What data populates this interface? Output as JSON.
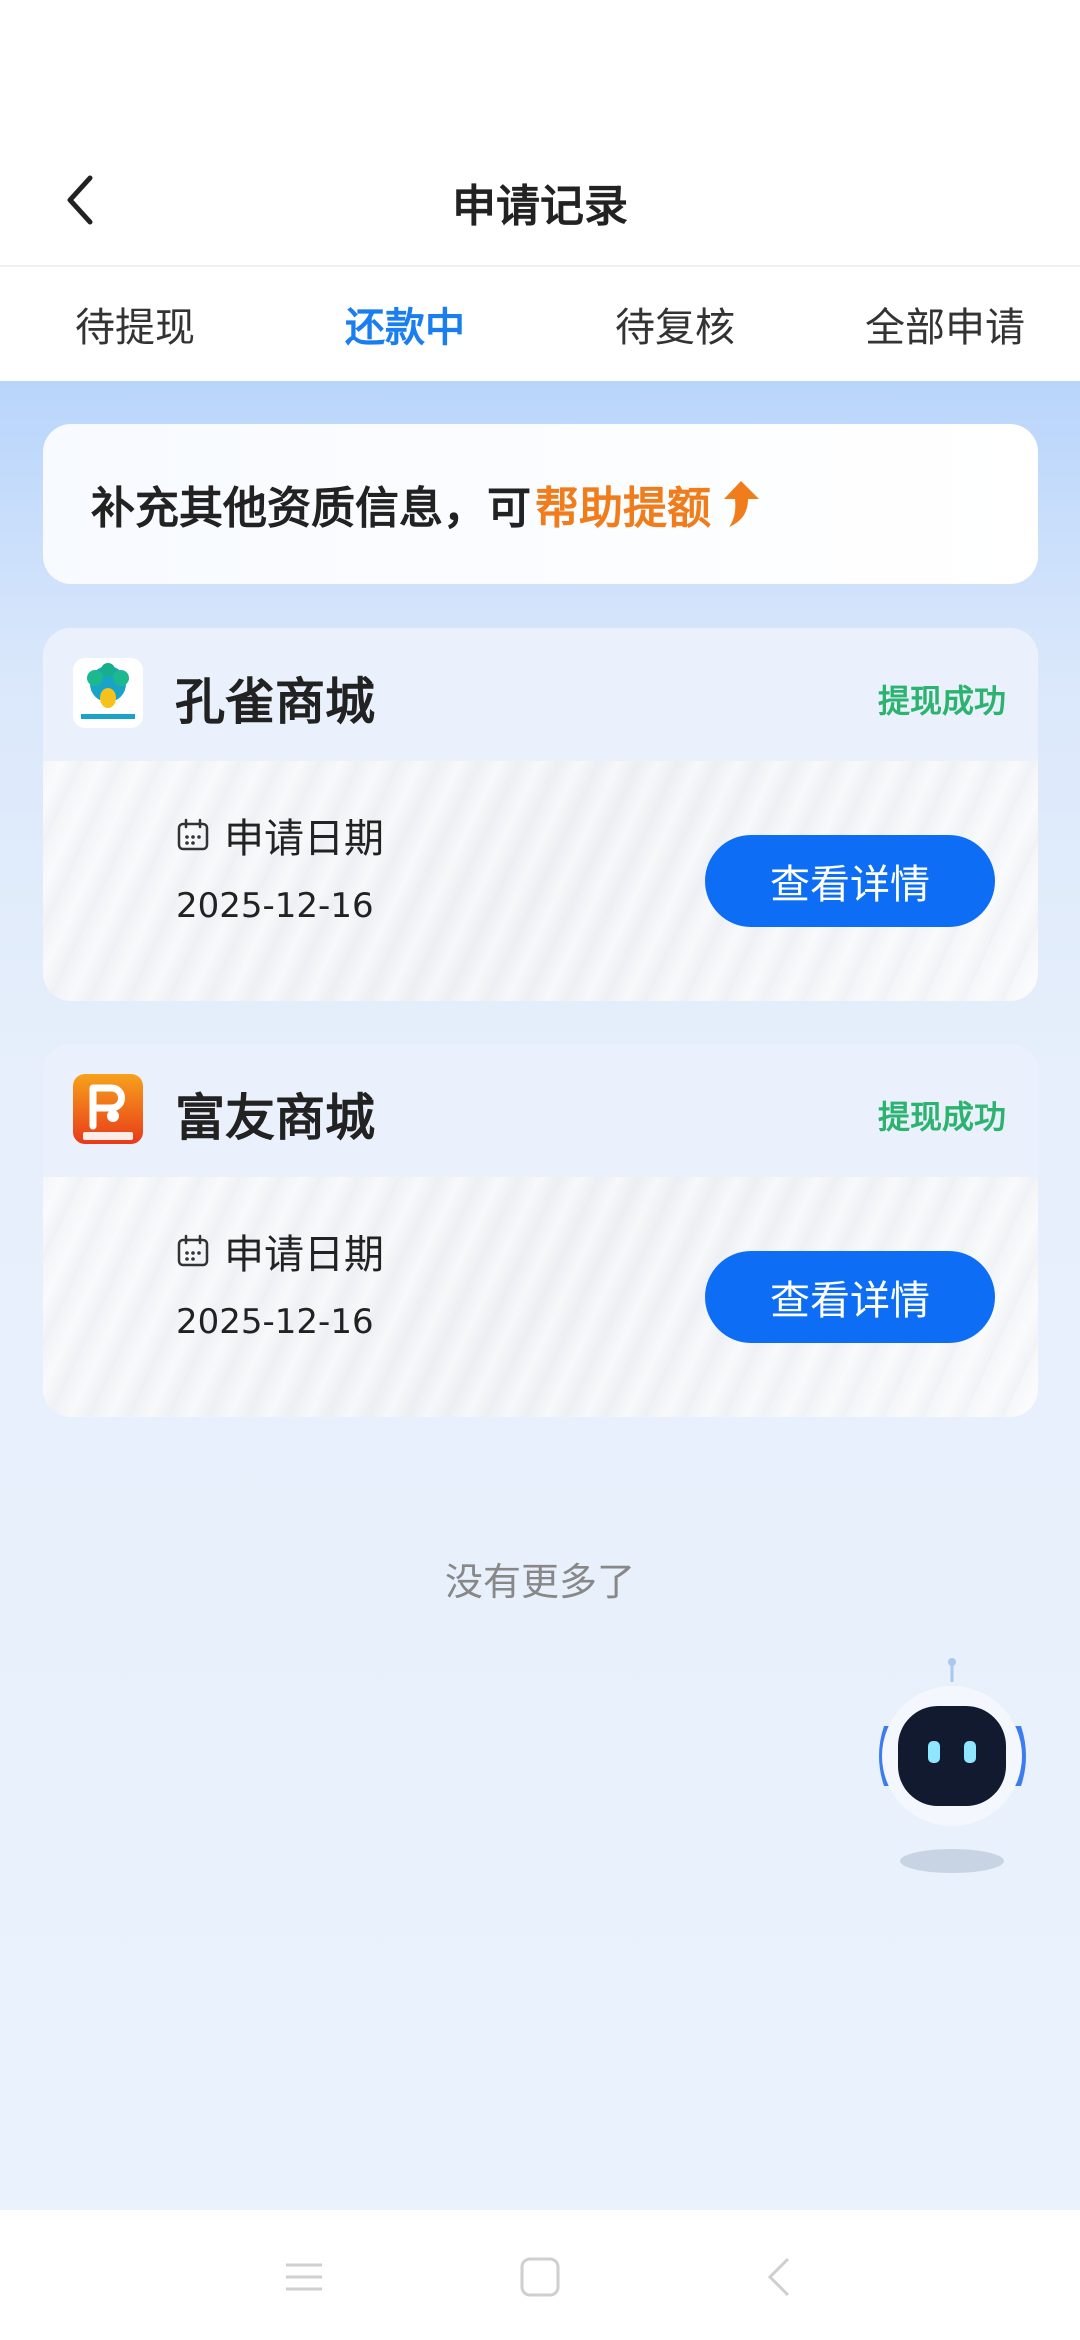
{
  "header": {
    "title": "申请记录"
  },
  "tabs": [
    {
      "label": "待提现",
      "active": false
    },
    {
      "label": "还款中",
      "active": true
    },
    {
      "label": "待复核",
      "active": false
    },
    {
      "label": "全部申请",
      "active": false
    }
  ],
  "promo": {
    "text": "补充其他资质信息，可",
    "highlight": "帮助提额"
  },
  "records": [
    {
      "name": "孔雀商城",
      "status": "提现成功",
      "date_label": "申请日期",
      "date": "2025-12-16",
      "button": "查看详情",
      "logo_icon": "peacock-logo"
    },
    {
      "name": "富友商城",
      "status": "提现成功",
      "date_label": "申请日期",
      "date": "2025-12-16",
      "button": "查看详情",
      "logo_icon": "fuyou-logo"
    }
  ],
  "footer": {
    "no_more": "没有更多了"
  },
  "colors": {
    "accent": "#1a7ef0",
    "button": "#0d6ef5",
    "success": "#2cb36f",
    "highlight": "#f07c1b"
  }
}
